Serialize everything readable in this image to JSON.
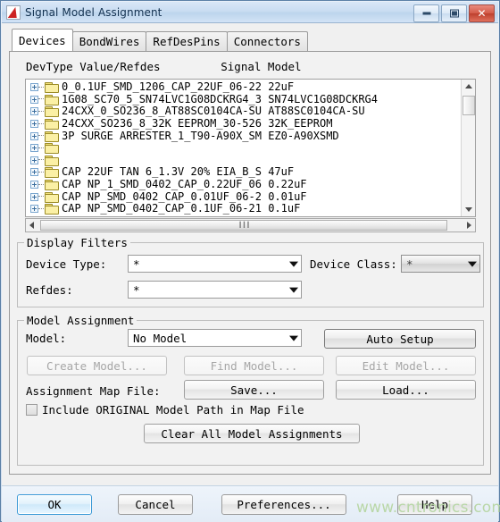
{
  "window": {
    "title": "Signal Model Assignment",
    "icon": "app-icon",
    "minimize_label": "",
    "maximize_label": "",
    "close_label": "✕"
  },
  "tabs": [
    {
      "label": "Devices",
      "active": true
    },
    {
      "label": "BondWires",
      "active": false
    },
    {
      "label": "RefDesPins",
      "active": false
    },
    {
      "label": "Connectors",
      "active": false
    }
  ],
  "list": {
    "header": "DevType Value/Refdes         Signal Model",
    "rows": [
      {
        "devtype": "0_0.1UF_SMD_1206_CAP_22UF_06-22 22uF"
      },
      {
        "devtype": "1G08_SC70_5_SN74LVC1G08DCKRG4_3 SN74LVC1G08DCKRG4"
      },
      {
        "devtype": "24CXX_0_SO236_8_AT88SC0104CA-SU AT88SC0104CA-SU"
      },
      {
        "devtype": "24CXX_SO236_8_32K EEPROM_30-526 32K_EEPROM"
      },
      {
        "devtype": "3P SURGE ARRESTER_1_T90-A90X_SM EZ0-A90XSMD"
      },
      {
        "devtype": ""
      },
      {
        "devtype": ""
      },
      {
        "devtype": "CAP 22UF TAN 6_1.3V 20% EIA_B_S 47uF"
      },
      {
        "devtype": "CAP NP_1_SMD_0402_CAP_0.22UF_06 0.22uF"
      },
      {
        "devtype": "CAP NP_SMD_0402_CAP_0.01UF_06-2 0.01uF"
      },
      {
        "devtype": "CAP NP_SMD_0402_CAP_0.1UF_06-21 0.1uF"
      }
    ],
    "scroll_up_icon": "scroll-up-arrow-icon",
    "scroll_down_icon": "scroll-down-arrow-icon",
    "scroll_left_icon": "scroll-left-arrow-icon",
    "scroll_right_icon": "scroll-right-arrow-icon",
    "hthumb_grip": "❙❙❙"
  },
  "display_filters": {
    "legend": "Display Filters",
    "device_type_label": "Device Type:",
    "device_type_value": "*",
    "device_class_label": "Device Class:",
    "device_class_value": "*",
    "refdes_label": "Refdes:",
    "refdes_value": "*"
  },
  "model_assignment": {
    "legend": "Model Assignment",
    "model_label": "Model:",
    "model_value": "No Model",
    "auto_setup": "Auto Setup",
    "create_model": "Create Model...",
    "find_model": "Find Model...",
    "edit_model": "Edit Model...",
    "map_file_label": "Assignment Map File:",
    "save": "Save...",
    "load": "Load...",
    "include_original_label": "Include ORIGINAL Model Path in Map File",
    "include_original_checked": false,
    "clear_all": "Clear All Model Assignments"
  },
  "footer": {
    "ok": "OK",
    "cancel": "Cancel",
    "preferences": "Preferences...",
    "help": "Help"
  },
  "watermark": {
    "text": "www.cntronics.com"
  }
}
